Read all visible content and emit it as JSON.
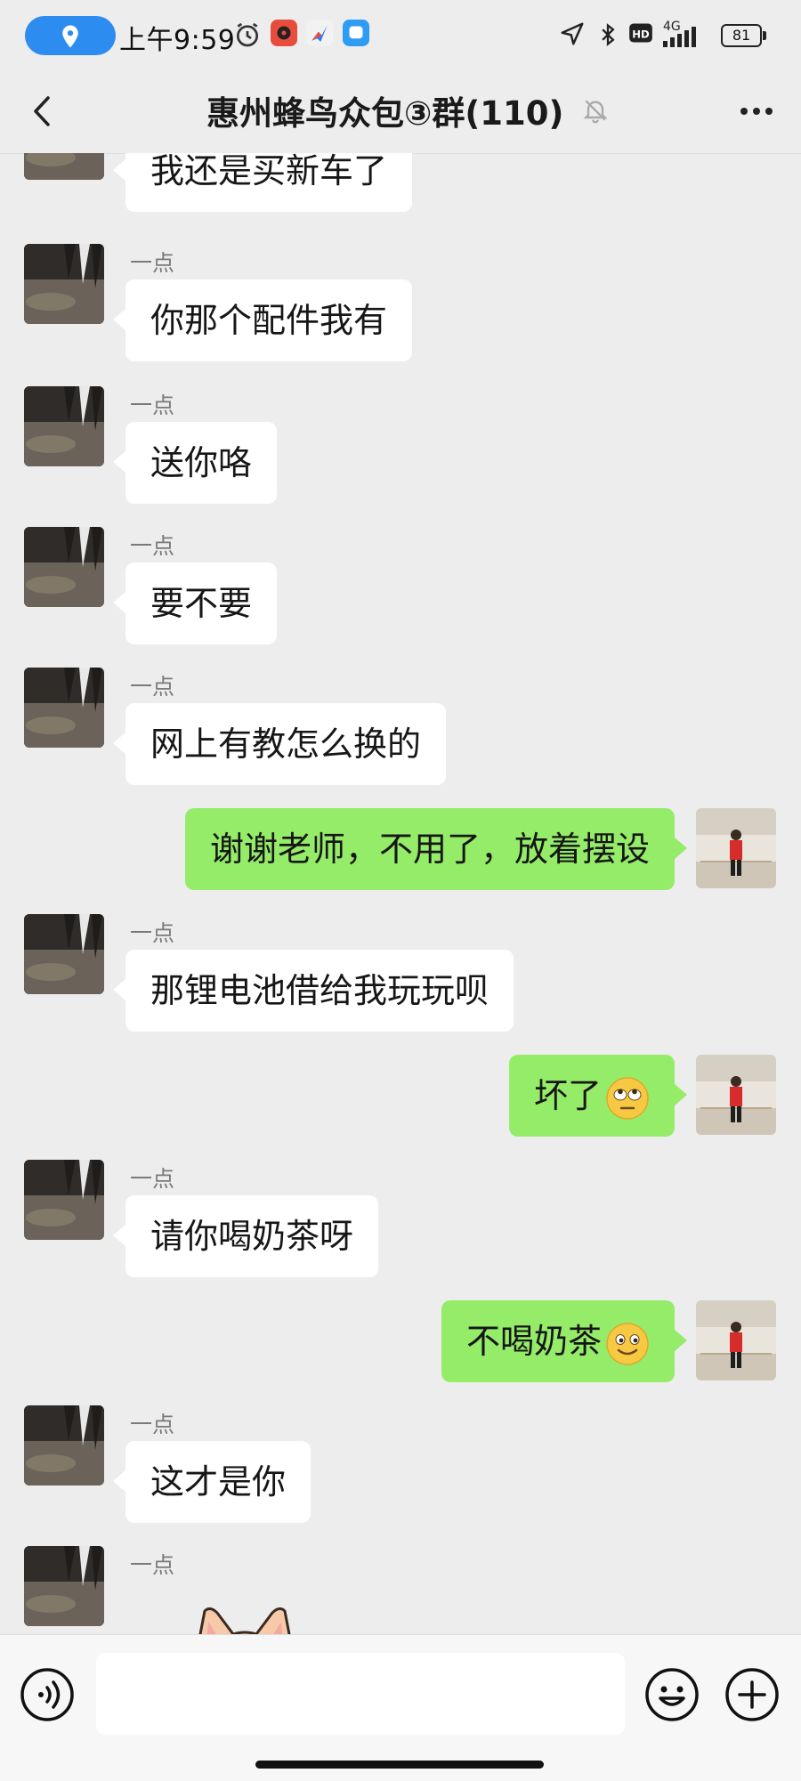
{
  "status_bar": {
    "time": "上午9:59",
    "network": "4G",
    "battery": "81",
    "icons": [
      "location-icon",
      "alarm-icon",
      "music-app-icon",
      "browser-app-icon",
      "message-app-icon",
      "location-arrow-icon",
      "bluetooth-icon",
      "hd-icon",
      "signal-icon",
      "battery-icon"
    ]
  },
  "header": {
    "title": "惠州蜂鸟众包③群(110)",
    "icons": [
      "back-icon",
      "mute-bell-icon",
      "more-icon"
    ]
  },
  "messages": [
    {
      "side": "in",
      "sender": "",
      "text": "我还是买新车了"
    },
    {
      "side": "in",
      "sender": "一点",
      "text": "你那个配件我有"
    },
    {
      "side": "in",
      "sender": "一点",
      "text": "送你咯"
    },
    {
      "side": "in",
      "sender": "一点",
      "text": "要不要"
    },
    {
      "side": "in",
      "sender": "一点",
      "text": "网上有教怎么换的"
    },
    {
      "side": "out",
      "text": "谢谢老师，不用了，放着摆设"
    },
    {
      "side": "in",
      "sender": "一点",
      "text": "那锂电池借给我玩玩呗"
    },
    {
      "side": "out",
      "text": "坏了",
      "emoji": "eye-roll-emoji"
    },
    {
      "side": "in",
      "sender": "一点",
      "text": "请你喝奶茶呀"
    },
    {
      "side": "out",
      "text": "不喝奶茶",
      "emoji": "smile-emoji"
    },
    {
      "side": "in",
      "sender": "一点",
      "text": "这才是你"
    },
    {
      "side": "in",
      "sender": "一点",
      "text": "",
      "sticker": "cat-sticker"
    }
  ],
  "input_bar": {
    "placeholder": "",
    "icons": [
      "voice-icon",
      "emoji-icon",
      "plus-icon"
    ]
  },
  "colors": {
    "background": "#ededed",
    "incoming_bubble": "#ffffff",
    "outgoing_bubble": "#95ec69",
    "accent_pill": "#2d8cf0"
  }
}
